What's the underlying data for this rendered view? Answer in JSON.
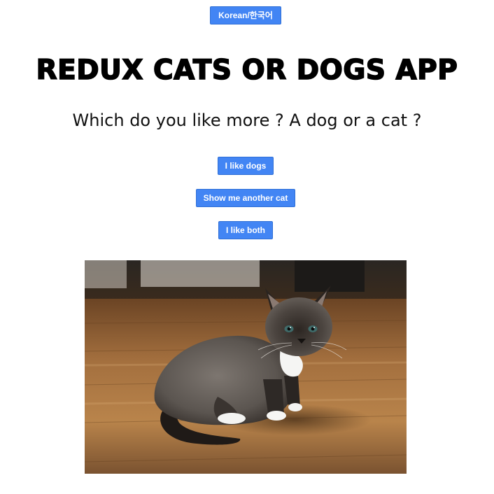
{
  "language_button": {
    "label": "Korean/한국어"
  },
  "header": {
    "title": "REDUX CATS OR DOGS APP",
    "question": "Which do you like more ? A dog or a cat ?"
  },
  "actions": {
    "like_dogs": "I like dogs",
    "another_cat": "Show me another cat",
    "like_both": "I like both"
  }
}
